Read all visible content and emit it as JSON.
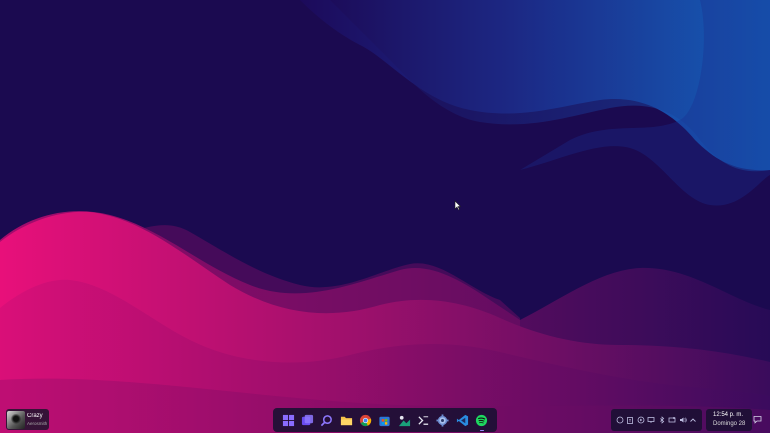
{
  "media": {
    "title": "Crazy",
    "artist": "Aerosmith",
    "icon": "album-art"
  },
  "taskbar": {
    "apps": [
      {
        "name": "start-button",
        "icon": "windows-logo-icon",
        "active": false
      },
      {
        "name": "task-view-button",
        "icon": "task-view-icon",
        "active": false
      },
      {
        "name": "search-button",
        "icon": "search-icon",
        "active": false
      },
      {
        "name": "file-explorer-button",
        "icon": "folder-icon",
        "active": false
      },
      {
        "name": "chrome-button",
        "icon": "chrome-icon",
        "active": false
      },
      {
        "name": "store-button",
        "icon": "store-icon",
        "active": false
      },
      {
        "name": "photos-button",
        "icon": "photos-icon",
        "active": false
      },
      {
        "name": "terminal-button",
        "icon": "terminal-icon",
        "active": false
      },
      {
        "name": "settings-button",
        "icon": "gear-icon",
        "active": false
      },
      {
        "name": "vscode-button",
        "icon": "code-icon",
        "active": false
      },
      {
        "name": "spotify-button",
        "icon": "spotify-icon",
        "active": true
      }
    ]
  },
  "tray": {
    "icons": [
      "clock-circle-icon",
      "clipboard-icon",
      "play-icon",
      "monitor-icon",
      "bluetooth-icon",
      "display-icon",
      "volume-icon",
      "chevron-up-icon"
    ]
  },
  "clock": {
    "time": "12:54 p. m.",
    "date": "Domingo 28"
  },
  "colors": {
    "accent": "#9b8cff",
    "taskbar_bg": "#1c1034",
    "wallpaper_base": "#1a0a4e"
  }
}
